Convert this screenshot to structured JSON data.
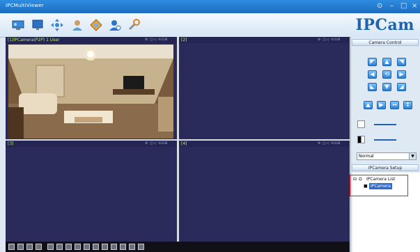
{
  "window": {
    "title": "IPCMultiViewer",
    "brand": "IPCam",
    "controls": [
      "⊙",
      "–",
      "□",
      "×"
    ]
  },
  "toolbar": {
    "icons": [
      "monitor-icon",
      "display-icon",
      "ptz-arrows-icon",
      "user-icon",
      "settings-icon",
      "add-user-icon",
      "tools-icon"
    ]
  },
  "panes": [
    {
      "label": "[1]IPCamera(P2P) 1 User"
    },
    {
      "label": "[2]"
    },
    {
      "label": "[3]"
    },
    {
      "label": "[4]"
    }
  ],
  "pane_icons": "⚙ ◫◁ ⟲⊡⊞",
  "sidebar": {
    "camera_control": "Camera Control",
    "mode_select": "Normal",
    "camera_setup": "IPCamera Setup",
    "tree_root": "IPCamera List",
    "tree_child": "IPCamera"
  },
  "colors": {
    "titlebar": "#1c6cc0",
    "pane_bg": "#2a2b5a",
    "pane_label": "#b6f06c",
    "highlight": "#e02020"
  }
}
